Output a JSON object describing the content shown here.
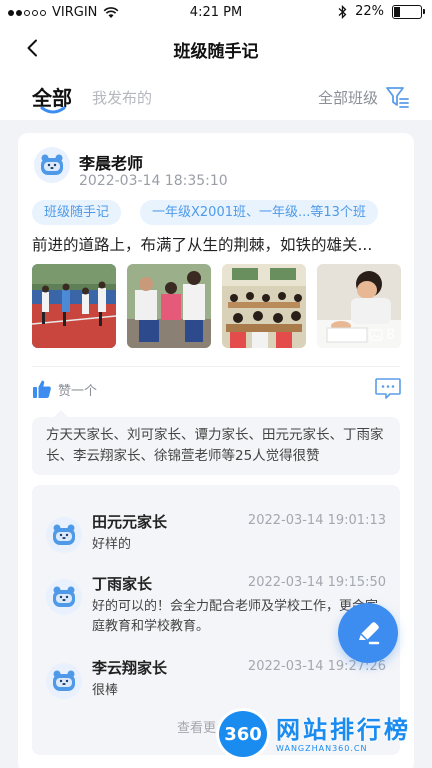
{
  "status_bar": {
    "carrier": "VIRGIN",
    "time": "4:21 PM",
    "battery": "22%",
    "battery_level": 0.22
  },
  "nav": {
    "title": "班级随手记"
  },
  "tabs": {
    "all": "全部",
    "mine": "我发布的",
    "class_filter": "全部班级"
  },
  "post": {
    "author": "李晨老师",
    "time": "2022-03-14 18:35:10",
    "tags": [
      "班级随手记",
      "一年级X2001班、一年级...等13个班"
    ],
    "text": "前进的道路上，布满了从生的荆棘，如铁的雄关...",
    "photo_count": "8",
    "like_label": "赞一个",
    "likes_text": "方天天家长、刘可家长、谭力家长、田元元家长、丁雨家长、李云翔家长、徐锦萱老师等25人觉得很赞",
    "comments": [
      {
        "name": "田元元家长",
        "time": "2022-03-14  19:01:13",
        "text": "好样的"
      },
      {
        "name": "丁雨家长",
        "time": "2022-03-14  19:15:50",
        "text": "好的可以的！会全力配合老师及学校工作，更会家庭教育和学校教育。"
      },
      {
        "name": "李云翔家长",
        "time": "2022-03-14  19:27:26",
        "text": "很棒"
      }
    ],
    "more": "查看更多评论"
  },
  "watermark": {
    "logo": "360",
    "title": "网站排行榜",
    "sub": "WANGZHAN360.CN"
  },
  "colors": {
    "accent": "#3d8df0",
    "tag_bg": "#e8f3fe",
    "tag_text": "#4f9ae8",
    "page_bg": "#f2f3f7"
  },
  "icons": [
    "wifi-icon",
    "bluetooth-icon",
    "back-chevron-icon",
    "filter-icon",
    "thumbs-up-icon",
    "comment-icon",
    "image-icon",
    "edit-pen-icon",
    "bear-avatar-icon"
  ]
}
